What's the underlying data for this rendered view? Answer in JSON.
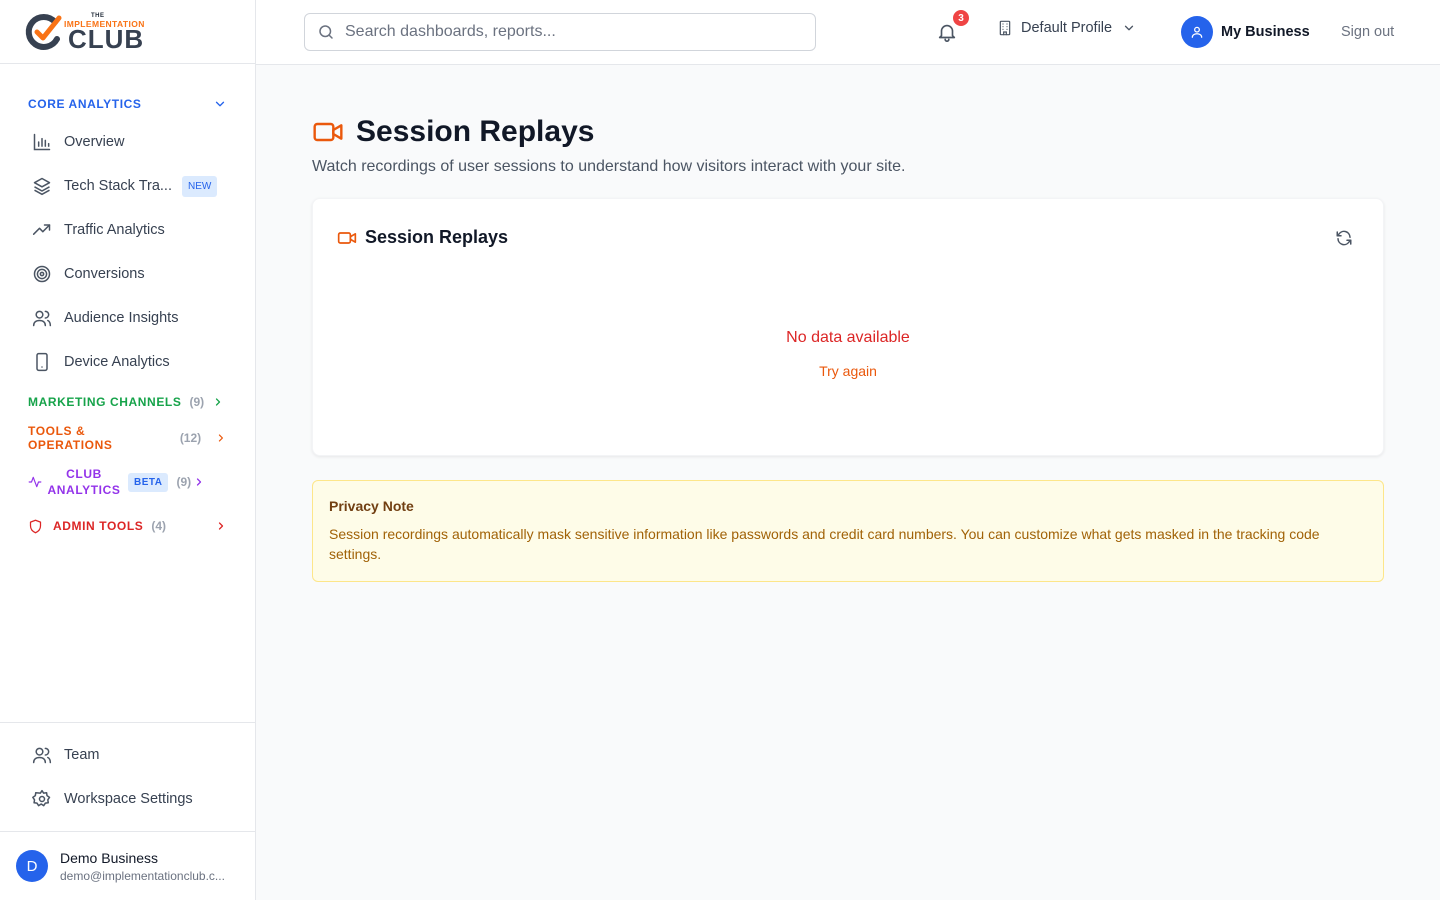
{
  "brand": {
    "logo_small": "THE",
    "logo_top": "IMPLEMENTATION",
    "logo_main": "CLUB"
  },
  "sidebar": {
    "core_section": "CORE ANALYTICS",
    "items": [
      {
        "label": "Overview",
        "icon": "bar-chart-icon"
      },
      {
        "label": "Tech Stack Tra...",
        "icon": "layers-icon",
        "badge": "NEW"
      },
      {
        "label": "Traffic Analytics",
        "icon": "trending-up-icon"
      },
      {
        "label": "Conversions",
        "icon": "target-icon"
      },
      {
        "label": "Audience Insights",
        "icon": "users-icon"
      },
      {
        "label": "Device Analytics",
        "icon": "smartphone-icon"
      }
    ],
    "marketing": {
      "label": "MARKETING CHANNELS",
      "count": "(9)"
    },
    "tools": {
      "label": "TOOLS & OPERATIONS",
      "count": "(12)"
    },
    "club": {
      "label_line1": "CLUB",
      "label_line2": "ANALYTICS",
      "badge": "BETA",
      "count": "(9)"
    },
    "admin": {
      "label": "ADMIN TOOLS",
      "count": "(4)"
    },
    "bottom_items": [
      {
        "label": "Team",
        "icon": "users-icon"
      },
      {
        "label": "Workspace Settings",
        "icon": "gear-icon"
      }
    ],
    "user": {
      "initial": "D",
      "name": "Demo Business",
      "email": "demo@implementationclub.c..."
    }
  },
  "header": {
    "search_placeholder": "Search dashboards, reports...",
    "notification_count": "3",
    "profile": "Default Profile",
    "business": "My Business",
    "signout": "Sign out"
  },
  "main": {
    "title": "Session Replays",
    "subtitle": "Watch recordings of user sessions to understand how visitors interact with your site.",
    "card_title": "Session Replays",
    "empty": "No data available",
    "retry": "Try again",
    "note_title": "Privacy Note",
    "note_text": "Session recordings automatically mask sensitive information like passwords and credit card numbers. You can customize what gets masked in the tracking code settings."
  },
  "colors": {
    "accent": "#2563eb",
    "brand_orange": "#f97316",
    "marketing": "#16a34a",
    "tools": "#ea580c",
    "club": "#9333ea",
    "admin": "#dc2626"
  }
}
